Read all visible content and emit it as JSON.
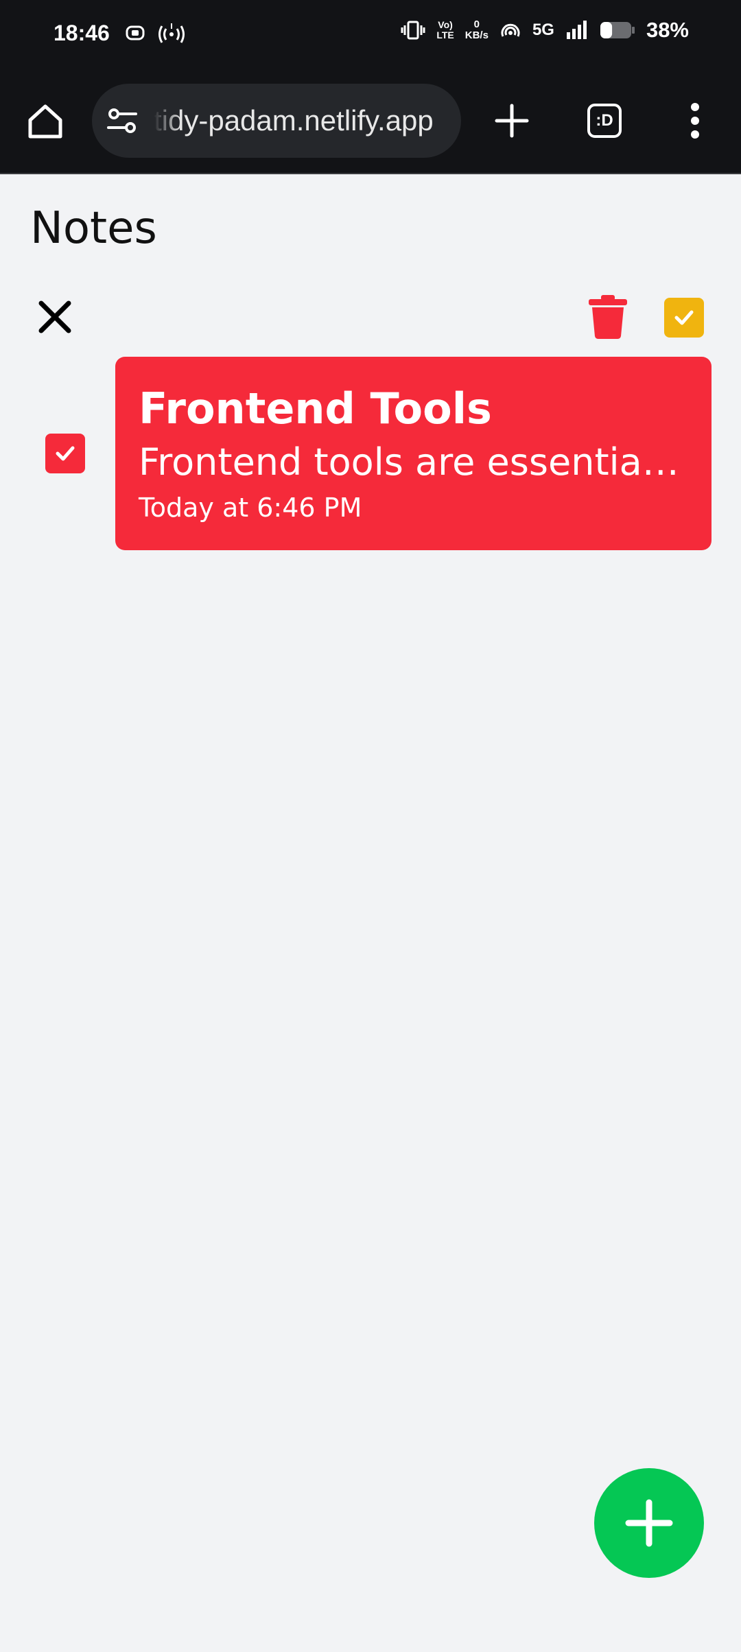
{
  "status_bar": {
    "time": "18:46",
    "speed_value": "0",
    "speed_unit": "KB/s",
    "volte_top": "Vo)",
    "volte_bottom": "LTE",
    "network": "5G",
    "battery_percent": "38%",
    "battery_level": 0.38
  },
  "browser": {
    "url": "tidy-padam.netlify.app",
    "tabs_label": ":D"
  },
  "page": {
    "title": "Notes"
  },
  "notes": [
    {
      "title": "Frontend Tools",
      "body": "Frontend tools are essential for modern web development",
      "time": "Today at 6:46 PM",
      "selected": true
    }
  ],
  "colors": {
    "note_red": "#f52a3a",
    "select_all_yellow": "#f0b40f",
    "fab_green": "#05c754",
    "delete_red": "#f52a3a"
  },
  "icons": {
    "home": "home-icon",
    "tune": "tune-icon",
    "add": "plus-icon",
    "menu": "more-vert-icon",
    "close": "close-icon",
    "delete": "trash-icon",
    "check": "check-icon"
  }
}
